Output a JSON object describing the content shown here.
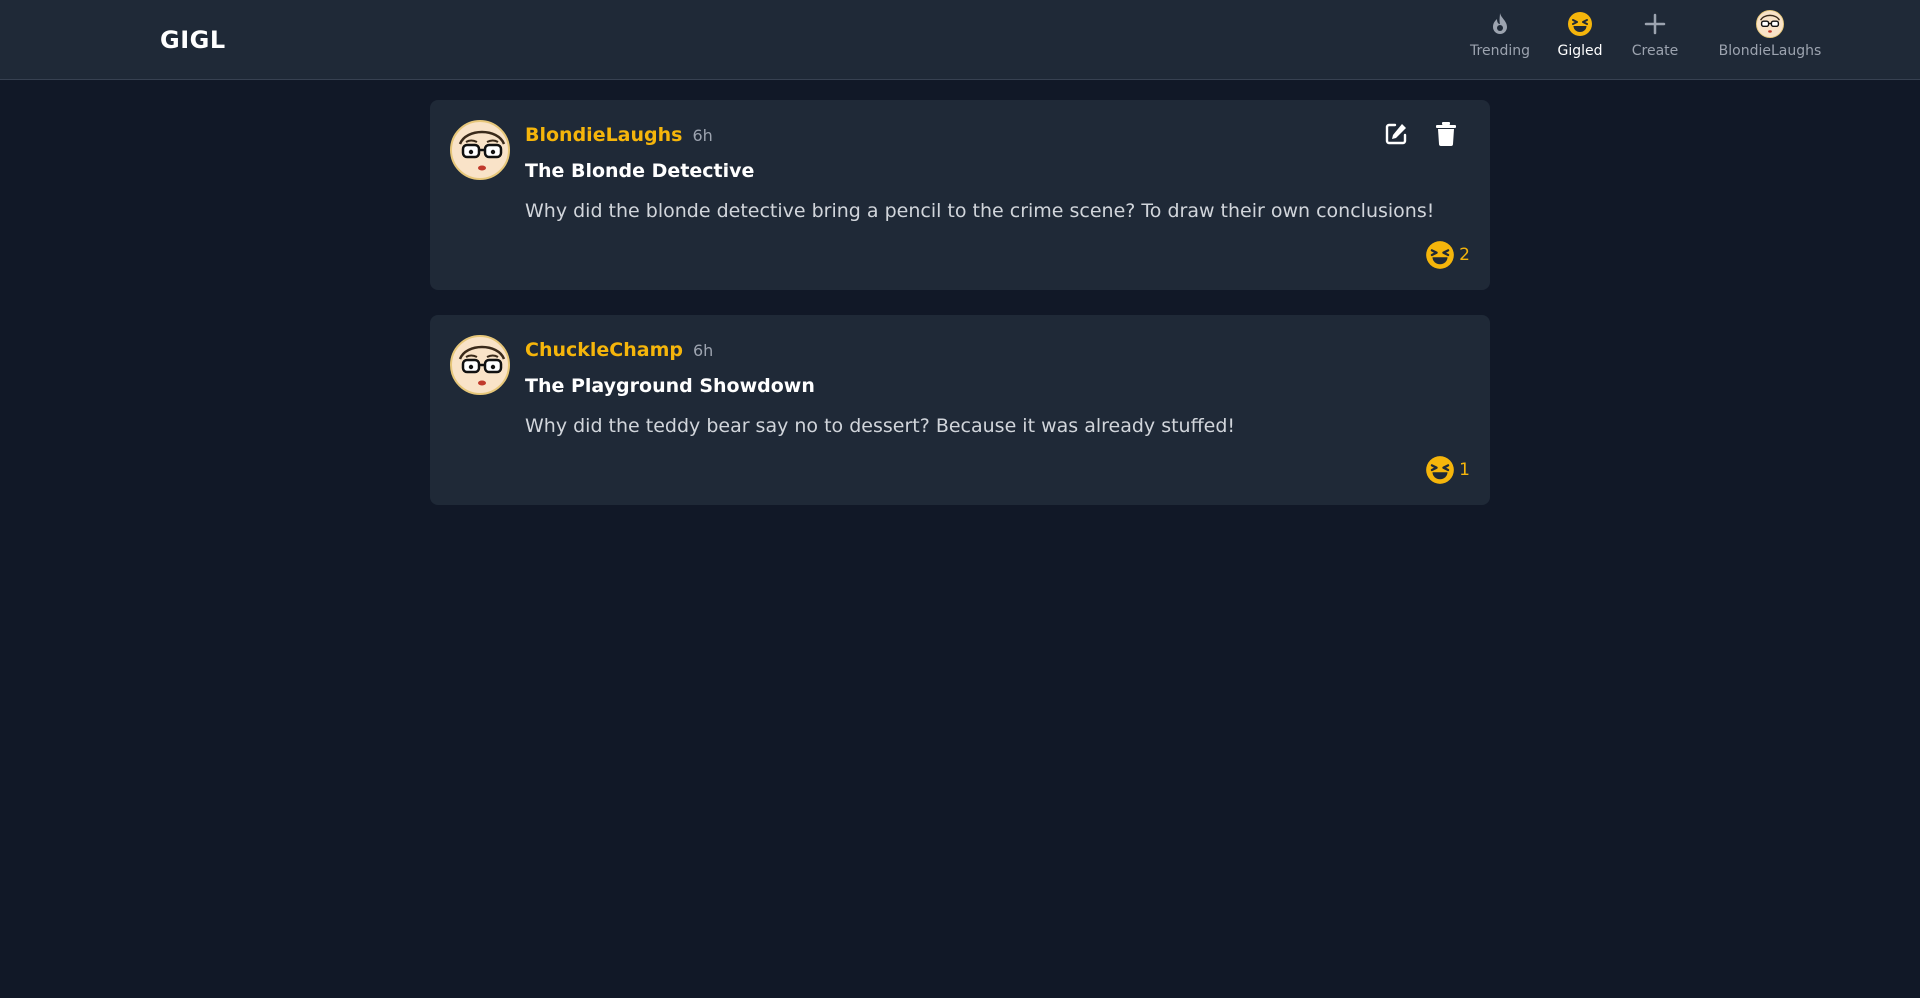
{
  "app": {
    "brand": "GIGL"
  },
  "nav": {
    "items": [
      {
        "label": "Trending",
        "icon": "flame-icon"
      },
      {
        "label": "Gigled",
        "icon": "laughing-face-icon",
        "active": true
      },
      {
        "label": "Create",
        "icon": "plus-icon"
      },
      {
        "label": "BlondieLaughs",
        "icon": "avatar-icon"
      }
    ]
  },
  "colors": {
    "background": "#111827",
    "surface": "#1f2937",
    "accent": "#f5b50b",
    "muted": "#9ca3af"
  },
  "posts": [
    {
      "username": "BlondieLaughs",
      "time": "6h",
      "title": "The Blonde Detective",
      "body": "Why did the blonde detective bring a pencil to the crime scene? To draw their own conclusions!",
      "giggles": "2",
      "owned": true
    },
    {
      "username": "ChuckleChamp",
      "time": "6h",
      "title": "The Playground Showdown",
      "body": "Why did the teddy bear say no to dessert? Because it was already stuffed!",
      "giggles": "1",
      "owned": false
    }
  ]
}
